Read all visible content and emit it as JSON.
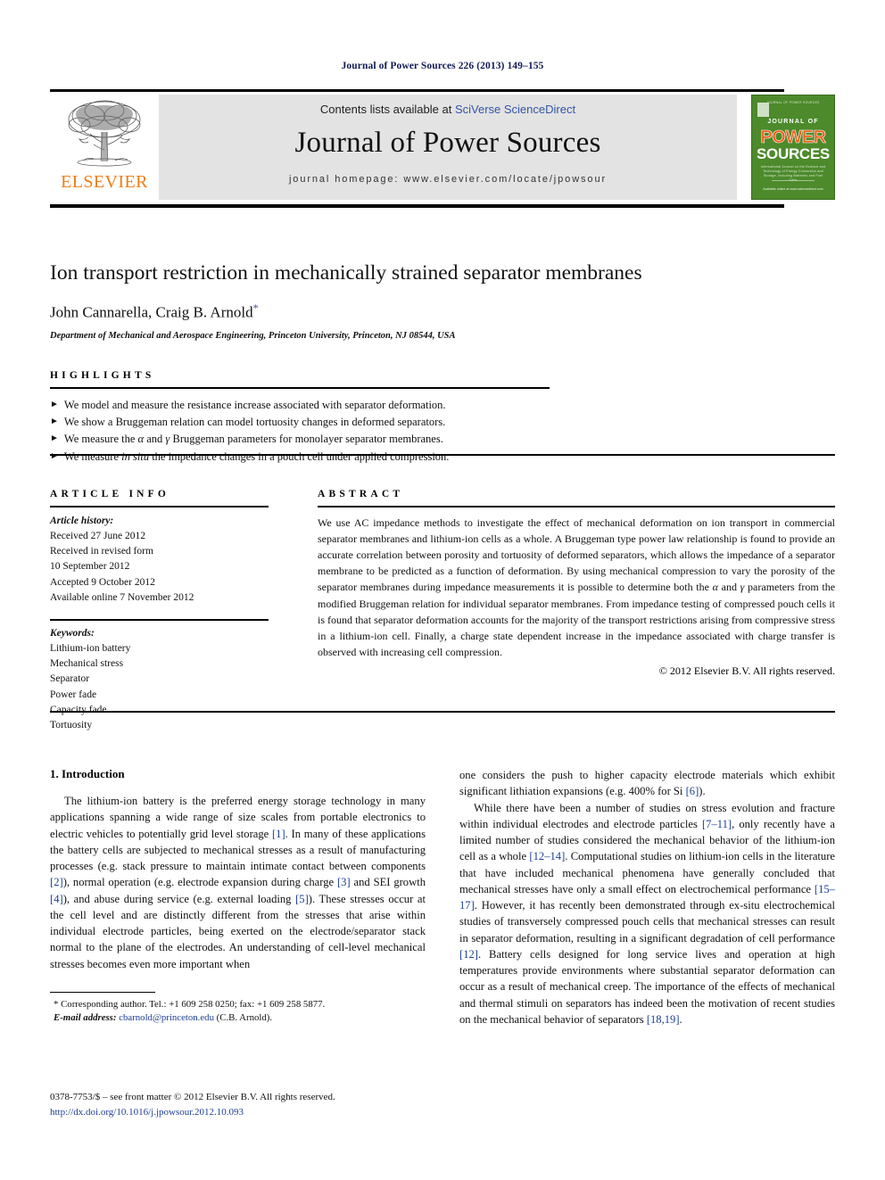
{
  "running_head": "Journal of Power Sources 226 (2013) 149–155",
  "header": {
    "contents_prefix": "Contents lists available at ",
    "sciencedirect_link": "SciVerse ScienceDirect",
    "journal_title": "Journal of Power Sources",
    "homepage_label": "journal homepage: www.elsevier.com/locate/jpowsour",
    "publisher_name": "ELSEVIER",
    "publisher_color": "#ef7c16",
    "link_color": "#3355aa",
    "cover": {
      "top_small": "JOURNAL OF POWER SOURCES",
      "line1": "JOURNAL OF",
      "line2": "POWER",
      "line3": "SOURCES",
      "subtitle": "International Journal on the Science and Technology of Energy Conversion and Storage, including Batteries and Fuel Cells",
      "footer": "Available online at www.sciencedirect.com",
      "bg_color": "#4c8a2b",
      "power_color": "#ef5b12"
    }
  },
  "article": {
    "title": "Ion transport restriction in mechanically strained separator membranes",
    "authors": "John Cannarella, Craig B. Arnold",
    "corresponding_marker": "*",
    "affiliation": "Department of Mechanical and Aerospace Engineering, Princeton University, Princeton, NJ 08544, USA"
  },
  "highlights": {
    "label": "HIGHLIGHTS",
    "bullet_glyph": "►",
    "items": [
      "We model and measure the resistance increase associated with separator deformation.",
      "We show a Bruggeman relation can model tortuosity changes in deformed separators.",
      "We measure the α and γ Bruggeman parameters for monolayer separator membranes.",
      "We measure in situ the impedance changes in a pouch cell under applied compression."
    ]
  },
  "article_info": {
    "label": "ARTICLE INFO",
    "history_heading": "Article history:",
    "history": [
      "Received 27 June 2012",
      "Received in revised form",
      "10 September 2012",
      "Accepted 9 October 2012",
      "Available online 7 November 2012"
    ],
    "keywords_heading": "Keywords:",
    "keywords": [
      "Lithium-ion battery",
      "Mechanical stress",
      "Separator",
      "Power fade",
      "Capacity fade",
      "Tortuosity"
    ]
  },
  "abstract": {
    "label": "ABSTRACT",
    "text": "We use AC impedance methods to investigate the effect of mechanical deformation on ion transport in commercial separator membranes and lithium-ion cells as a whole. A Bruggeman type power law relationship is found to provide an accurate correlation between porosity and tortuosity of deformed separators, which allows the impedance of a separator membrane to be predicted as a function of deformation. By using mechanical compression to vary the porosity of the separator membranes during impedance measurements it is possible to determine both the α and γ parameters from the modified Bruggeman relation for individual separator membranes. From impedance testing of compressed pouch cells it is found that separator deformation accounts for the majority of the transport restrictions arising from compressive stress in a lithium-ion cell. Finally, a charge state dependent increase in the impedance associated with charge transfer is observed with increasing cell compression.",
    "copyright": "© 2012 Elsevier B.V. All rights reserved."
  },
  "body": {
    "section_number_title": "1. Introduction",
    "left_paragraph": "The lithium-ion battery is the preferred energy storage technology in many applications spanning a wide range of size scales from portable electronics to electric vehicles to potentially grid level storage [1]. In many of these applications the battery cells are subjected to mechanical stresses as a result of manufacturing processes (e.g. stack pressure to maintain intimate contact between components [2]), normal operation (e.g. electrode expansion during charge [3] and SEI growth [4]), and abuse during service (e.g. external loading [5]). These stresses occur at the cell level and are distinctly different from the stresses that arise within individual electrode particles, being exerted on the electrode/separator stack normal to the plane of the electrodes. An understanding of cell-level mechanical stresses becomes even more important when",
    "right_paragraph_1": "one considers the push to higher capacity electrode materials which exhibit significant lithiation expansions (e.g. 400% for Si [6]).",
    "right_paragraph_2": "While there have been a number of studies on stress evolution and fracture within individual electrodes and electrode particles [7–11], only recently have a limited number of studies considered the mechanical behavior of the lithium-ion cell as a whole [12–14]. Computational studies on lithium-ion cells in the literature that have included mechanical phenomena have generally concluded that mechanical stresses have only a small effect on electrochemical performance [15–17]. However, it has recently been demonstrated through ex-situ electrochemical studies of transversely compressed pouch cells that mechanical stresses can result in separator deformation, resulting in a significant degradation of cell performance [12]. Battery cells designed for long service lives and operation at high temperatures provide environments where substantial separator deformation can occur as a result of mechanical creep. The importance of the effects of mechanical and thermal stimuli on separators has indeed been the motivation of recent studies on the mechanical behavior of separators [18,19]."
  },
  "footnote": {
    "corresponding": "* Corresponding author. Tel.: +1 609 258 0250; fax: +1 609 258 5877.",
    "email_label": "E-mail address:",
    "email": "cbarnold@princeton.edu",
    "email_suffix": "(C.B. Arnold)."
  },
  "imprint": {
    "issn_line": "0378-7753/$ – see front matter © 2012 Elsevier B.V. All rights reserved.",
    "doi": "http://dx.doi.org/10.1016/j.jpowsour.2012.10.093"
  }
}
